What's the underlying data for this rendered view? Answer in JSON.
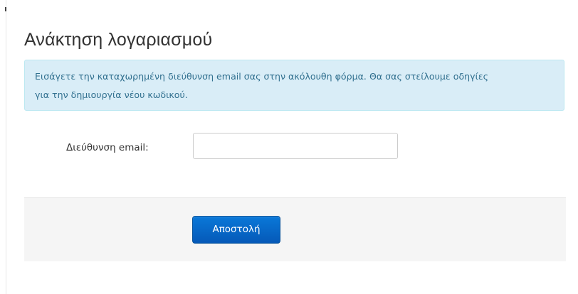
{
  "page": {
    "title": "Ανάκτηση λογαριασμού"
  },
  "alert": {
    "text": "Εισάγετε την καταχωρημένη διεύθυνση email σας στην ακόλουθη φόρμα. Θα σας στείλουμε οδηγίες για την δημιουργία νέου κωδικού."
  },
  "form": {
    "email_label": "Διεύθυνση email:",
    "email_value": "",
    "email_placeholder": ""
  },
  "actions": {
    "submit_label": "Αποστολή"
  },
  "colors": {
    "alert_background": "#d9edf7",
    "alert_text": "#31708f",
    "button_background": "#0a6ccb",
    "actions_background": "#f5f5f5"
  }
}
